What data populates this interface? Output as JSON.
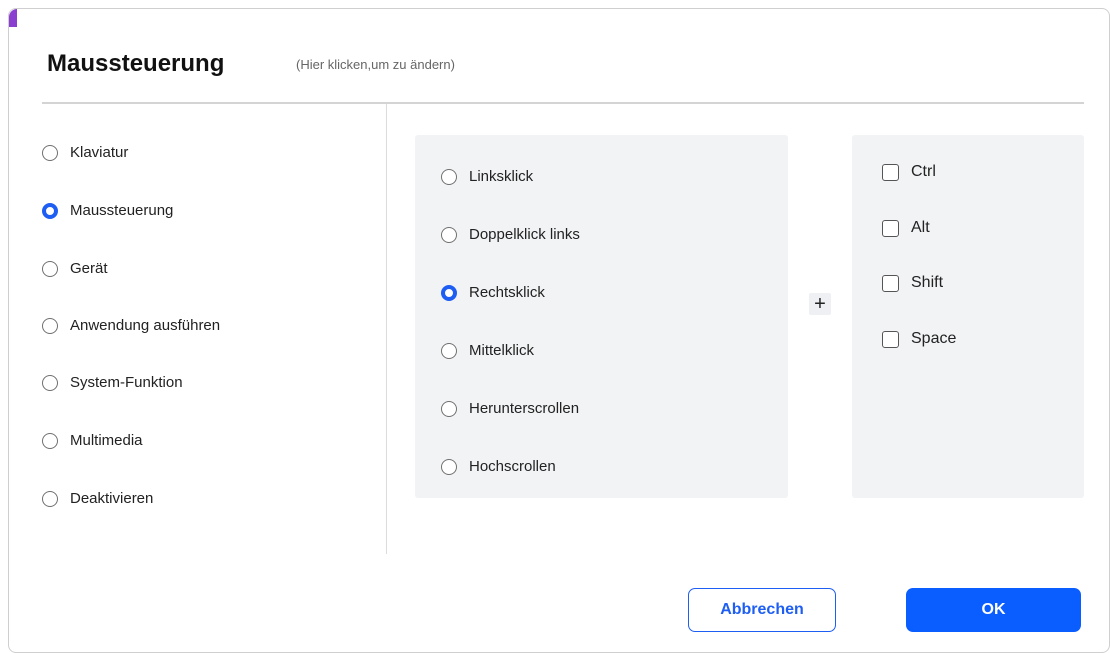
{
  "dialog": {
    "title": "Maussteuerung",
    "subtitle": "(Hier klicken,um zu ändern)"
  },
  "categories": [
    {
      "label": "Klaviatur",
      "selected": false
    },
    {
      "label": "Maussteuerung",
      "selected": true
    },
    {
      "label": "Gerät",
      "selected": false
    },
    {
      "label": "Anwendung ausführen",
      "selected": false
    },
    {
      "label": "System-Funktion",
      "selected": false
    },
    {
      "label": "Multimedia",
      "selected": false
    },
    {
      "label": "Deaktivieren",
      "selected": false
    }
  ],
  "mouse_actions": [
    {
      "label": "Linksklick",
      "selected": false
    },
    {
      "label": "Doppelklick links",
      "selected": false
    },
    {
      "label": "Rechtsklick",
      "selected": true
    },
    {
      "label": "Mittelklick",
      "selected": false
    },
    {
      "label": "Herunterscrollen",
      "selected": false
    },
    {
      "label": "Hochscrollen",
      "selected": false
    }
  ],
  "plus_symbol": "+",
  "modifiers": [
    {
      "label": "Ctrl",
      "checked": false
    },
    {
      "label": "Alt",
      "checked": false
    },
    {
      "label": "Shift",
      "checked": false
    },
    {
      "label": "Space",
      "checked": false
    }
  ],
  "buttons": {
    "cancel": "Abbrechen",
    "ok": "OK"
  },
  "colors": {
    "accent": "#1e5ef3",
    "ok_button": "#0a5dff",
    "panel_bg": "#f2f3f5"
  }
}
